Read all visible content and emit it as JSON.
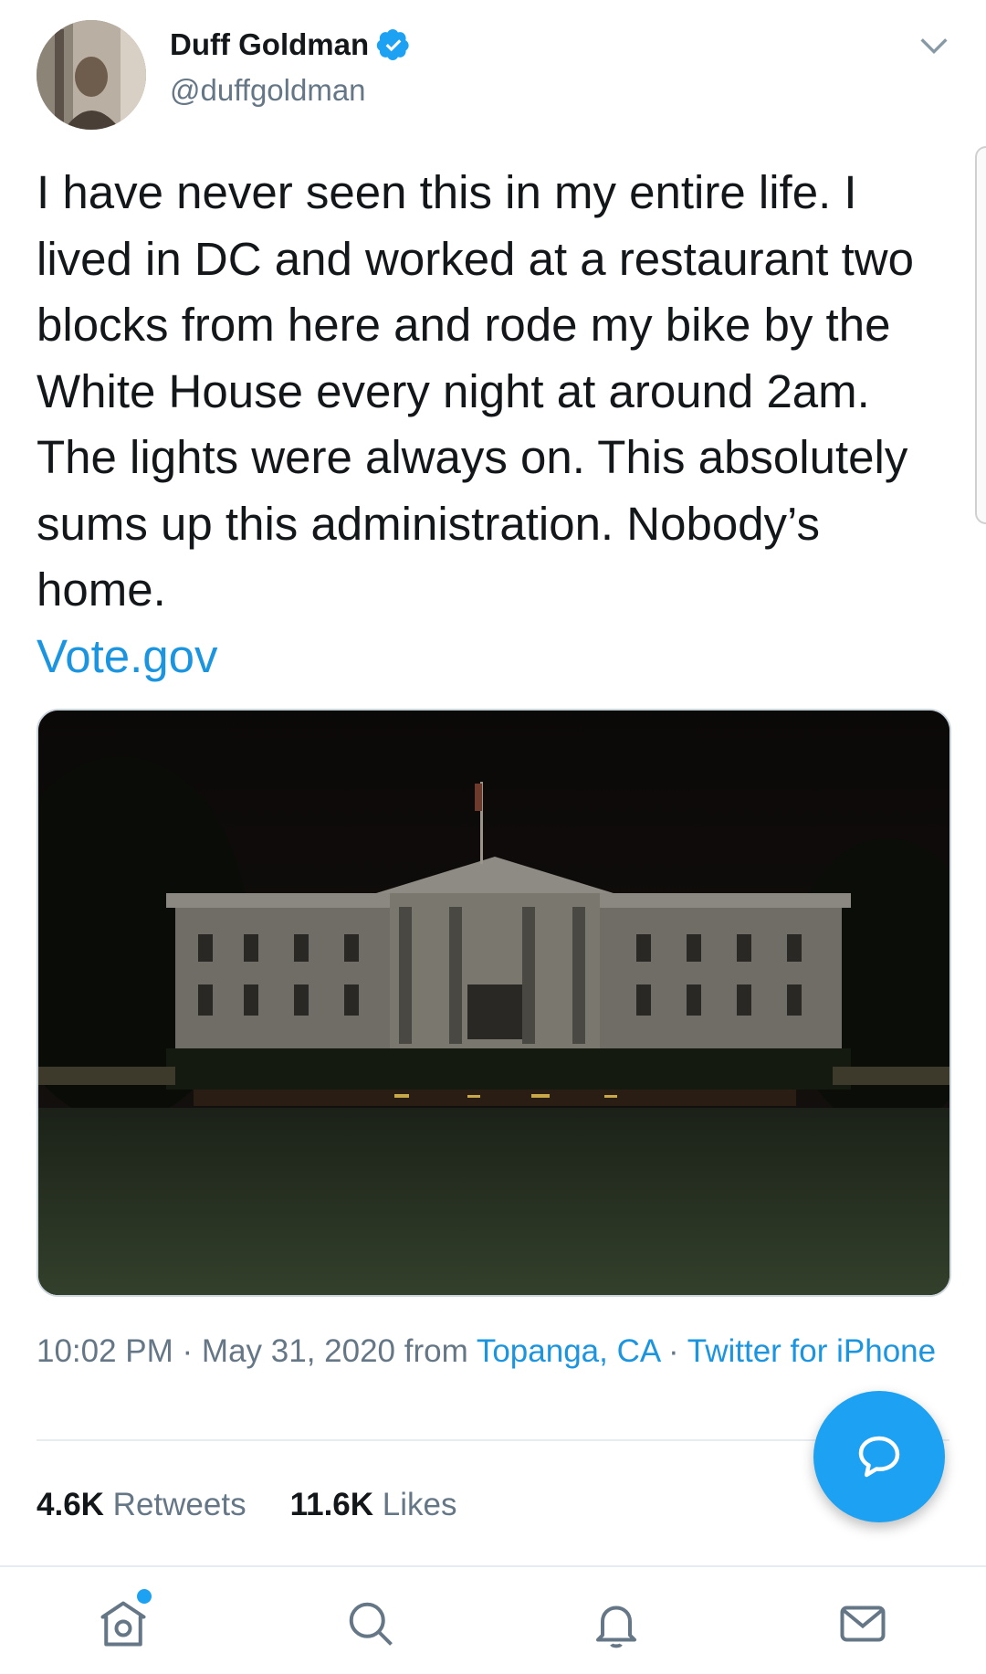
{
  "tweet": {
    "author_name": "Duff Goldman",
    "handle": "@duffgoldman",
    "text": "I have never seen this in my entire life. I lived in DC and worked at a restaurant two blocks from here and rode my bike by the White House every night at around 2am. The lights were always on. This absolutely sums up this administration. Nobody’s home.",
    "link": "Vote.gov",
    "time": "10:02 PM · May 31, 2020 from ",
    "location": "Topanga, CA",
    "separator": " · ",
    "source": "Twitter for iPhone",
    "retweets_count": "4.6K",
    "retweets_label": "Retweets",
    "likes_count": "11.6K",
    "likes_label": "Likes"
  },
  "colors": {
    "accent": "#1da1f2",
    "link": "#1b95e0",
    "muted": "#657786"
  },
  "icons": {
    "verified": "verified-badge-icon",
    "chevron": "chevron-down-icon",
    "fab": "compose-reply-icon",
    "tabs": [
      "home-icon",
      "search-icon",
      "notifications-icon",
      "messages-icon"
    ]
  }
}
